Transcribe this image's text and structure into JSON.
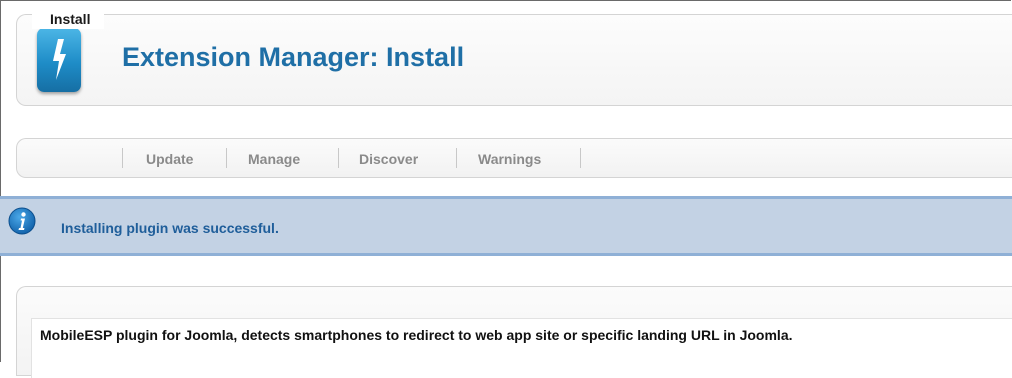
{
  "header": {
    "icon": "lightning-bolt-icon",
    "title": "Extension Manager: Install"
  },
  "tabs": [
    {
      "label": "Install",
      "active": true
    },
    {
      "label": "Update",
      "active": false
    },
    {
      "label": "Manage",
      "active": false
    },
    {
      "label": "Discover",
      "active": false
    },
    {
      "label": "Warnings",
      "active": false
    }
  ],
  "message": {
    "icon": "info-icon",
    "text": "Installing plugin was successful."
  },
  "description": {
    "text": "MobileESP plugin for Joomla, detects smartphones to redirect to web app site or specific landing URL in Joomla."
  },
  "colors": {
    "title": "#1f6fa6",
    "message_background": "#c3d2e4",
    "message_text": "#1f5e9a",
    "icon_blue": "#1e8cc7"
  }
}
